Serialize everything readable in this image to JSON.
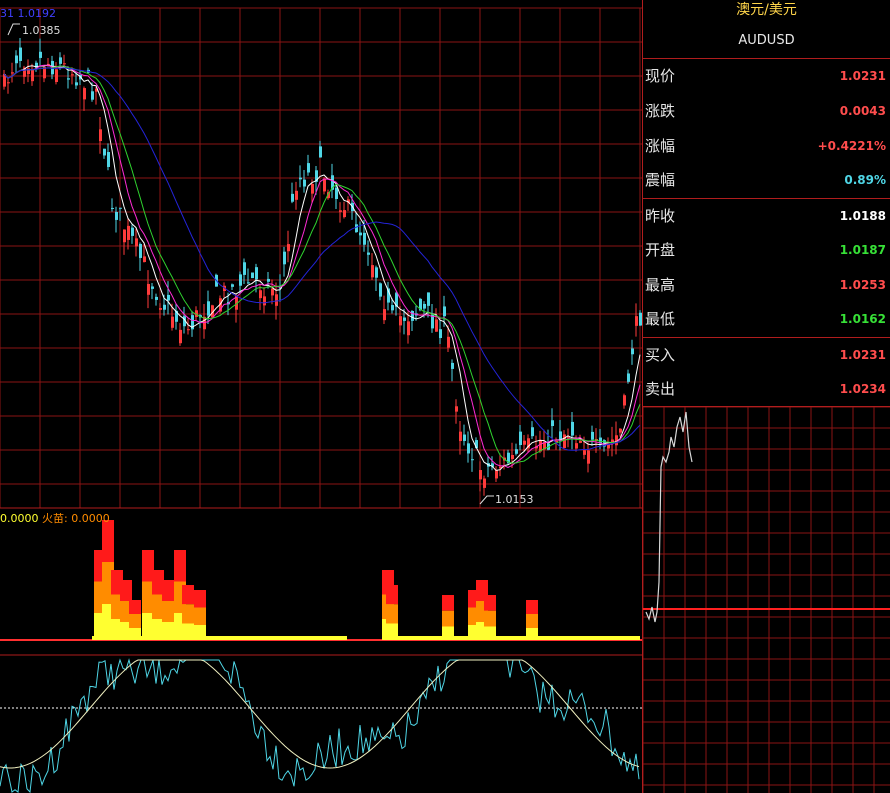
{
  "chart": {
    "main_legend_prefix": "31",
    "main_legend_value": "1.0192",
    "high_marker": "1.0385",
    "low_marker": "1.0153",
    "indicator_legend_value": "0.0000",
    "indicator_legend_name": "火苗:",
    "indicator_legend_name_value": "0.0000"
  },
  "quote": {
    "title": "澳元/美元",
    "symbol": "AUDUSD",
    "rows": [
      {
        "label": "现价",
        "value": "1.0231",
        "color": "#ff4d4d"
      },
      {
        "label": "涨跌",
        "value": "0.0043",
        "color": "#ff4d4d"
      },
      {
        "label": "涨幅",
        "value": "+0.4221%",
        "color": "#ff4d4d"
      },
      {
        "label": "震幅",
        "value": "0.89%",
        "color": "#4fd6e6"
      },
      {
        "label": "昨收",
        "value": "1.0188",
        "color": "#ffffff"
      },
      {
        "label": "开盘",
        "value": "1.0187",
        "color": "#37e137"
      },
      {
        "label": "最高",
        "value": "1.0253",
        "color": "#ff4d4d"
      },
      {
        "label": "最低",
        "value": "1.0162",
        "color": "#37e137"
      },
      {
        "label": "买入",
        "value": "1.0231",
        "color": "#ff4d4d"
      },
      {
        "label": "卖出",
        "value": "1.0234",
        "color": "#ff4d4d"
      }
    ]
  },
  "colors": {
    "grid": "#8a1414",
    "up_candle": "#ff3b3b",
    "down_candle": "#4fd6e6",
    "ma_fast": "#ffffff",
    "ma_mid": "#ff2bd6",
    "ma_slow": "#2fd32f",
    "ma_long": "#2424d8",
    "flame_top": "#ff1a1a",
    "flame_mid": "#ff8c00",
    "flame_base": "#ffff30",
    "osc_fast": "#4fd6e6",
    "osc_slow": "#f0f0c0",
    "mini_line": "#d8d8d8"
  }
}
